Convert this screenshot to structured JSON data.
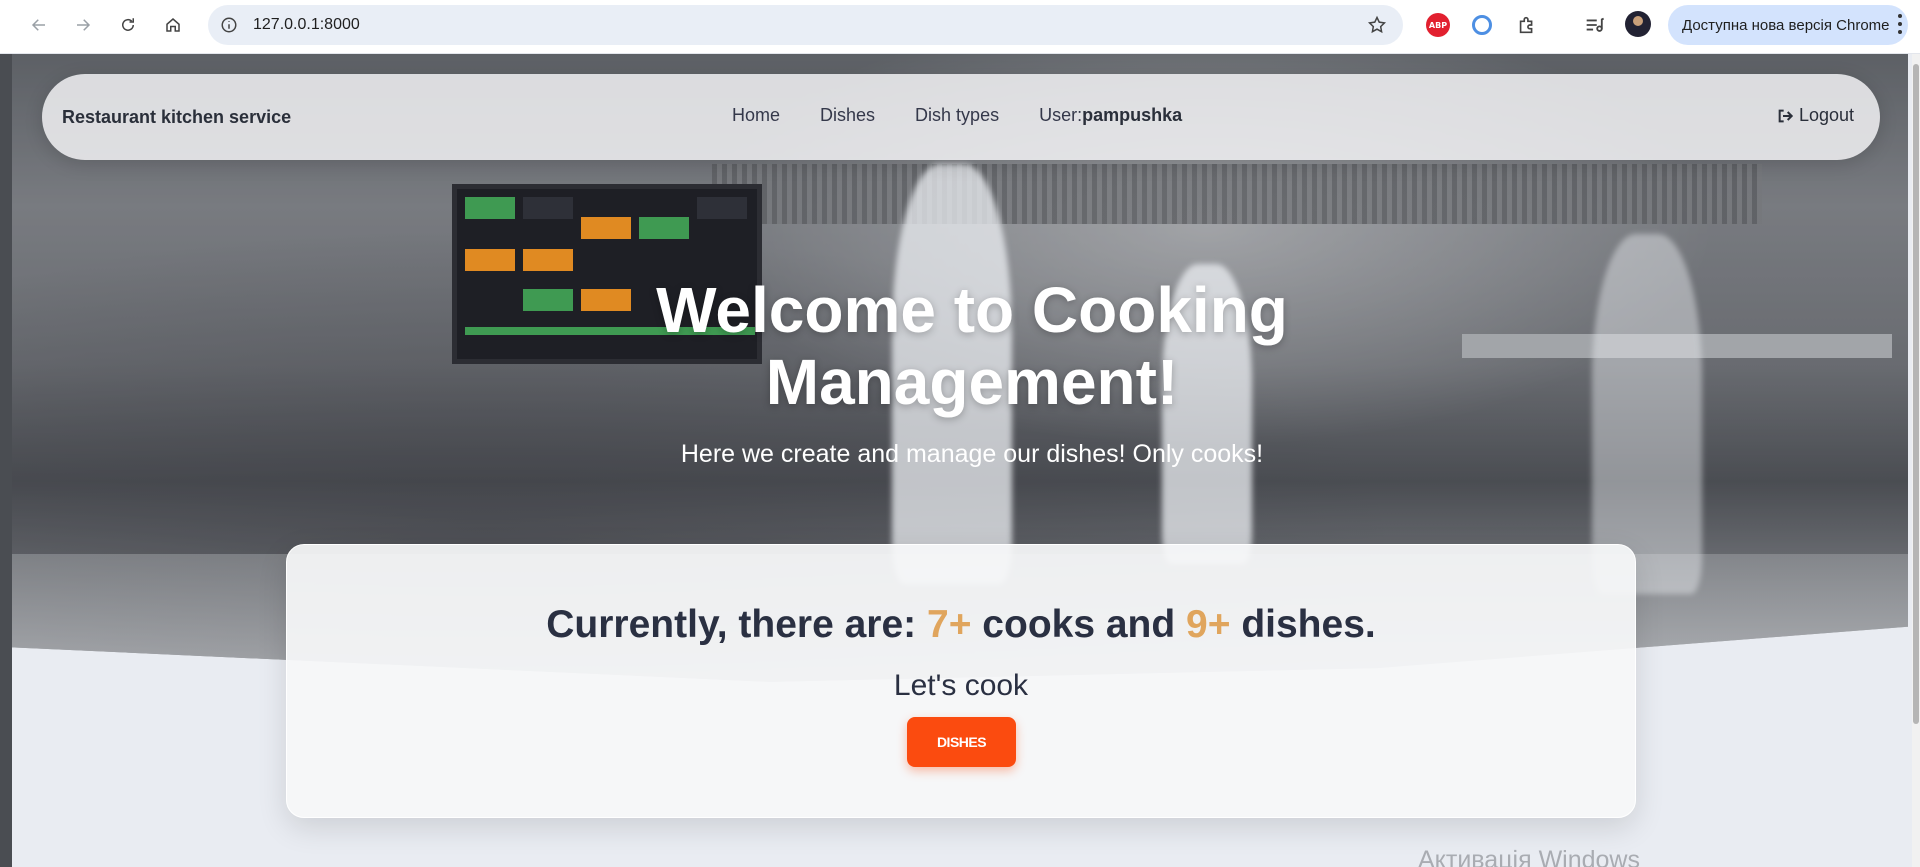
{
  "browser": {
    "url": "127.0.0.1:8000",
    "update_label": "Доступна нова версія Chrome",
    "abp_label": "ABP"
  },
  "navbar": {
    "brand": "Restaurant kitchen service",
    "items": [
      "Home",
      "Dishes",
      "Dish types"
    ],
    "user_prefix": "User:",
    "user_name": "pampushka",
    "logout": "Logout"
  },
  "hero": {
    "title": "Welcome to Cooking Management!",
    "subtitle": "Here we create and manage our dishes! Only cooks!"
  },
  "card": {
    "stats_prefix": "Currently, there are: ",
    "cooks_count": "7+",
    "cooks_label": " cooks and ",
    "dishes_count": "9+",
    "dishes_label": " dishes.",
    "lets_cook": "Let's cook",
    "button": "DISHES"
  },
  "watermark": "Активація Windows",
  "colors": {
    "accent": "#fb4b0f",
    "highlight": "#e0a55d",
    "text_dark": "#2a3042"
  }
}
